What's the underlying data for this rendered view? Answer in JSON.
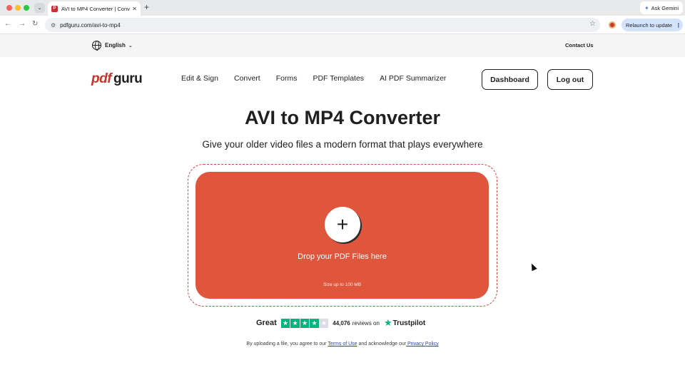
{
  "browser": {
    "tab_title": "AVI to MP4 Converter | Conve",
    "favicon_letter": "P",
    "url": "pdfguru.com/avi-to-mp4",
    "ask_gemini": "Ask Gemini",
    "relaunch": "Relaunch to update",
    "icons": [
      "chevron-down-icon",
      "close-icon",
      "plus-icon",
      "back-icon",
      "forward-icon",
      "reload-icon",
      "tune-icon",
      "star-icon",
      "kebab-icon"
    ]
  },
  "topstrip": {
    "language": "English",
    "contact": "Contact Us"
  },
  "header": {
    "logo_pdf": "pdf",
    "logo_guru": "guru",
    "nav": [
      "Edit & Sign",
      "Convert",
      "Forms",
      "PDF Templates",
      "AI PDF Summarizer"
    ],
    "dashboard": "Dashboard",
    "logout": "Log out"
  },
  "hero": {
    "title": "AVI to MP4 Converter",
    "subtitle": "Give your older video files a modern format that plays everywhere"
  },
  "upload": {
    "plus": "+",
    "drop_label": "Drop your PDF Files here",
    "size_label": "Size up to 100 MB"
  },
  "trustpilot": {
    "rating_word": "Great",
    "stars_filled": 4,
    "stars_total": 5,
    "count": "44,076",
    "reviews_on": "reviews on",
    "brand": "Trustpilot"
  },
  "consent": {
    "prefix": "By uploading a file, you agree to our ",
    "terms": "Terms of Use",
    "middle": " and acknowledge our",
    "privacy": " Privacy Policy"
  },
  "colors": {
    "accent": "#df563d",
    "logo_red": "#c8352c",
    "trustpilot_green": "#00b67a",
    "link": "#2a3fc7"
  }
}
